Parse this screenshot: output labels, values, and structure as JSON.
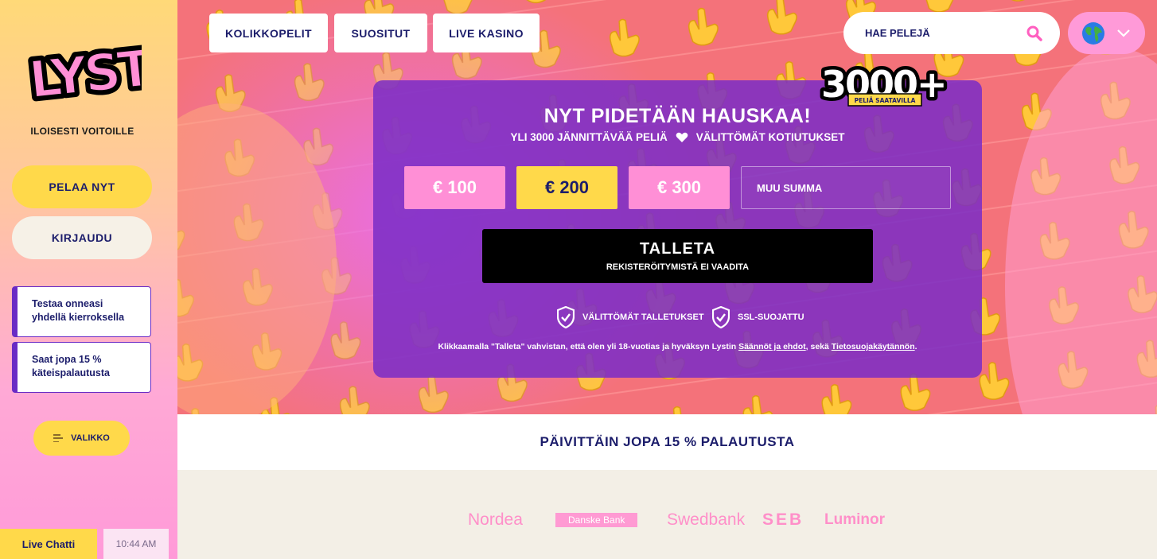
{
  "sidebar": {
    "logo_text": "LYSTI",
    "tagline": "ILOISESTI VOITOILLE",
    "play_label": "PELAA NYT",
    "login_label": "KIRJAUDU",
    "promos": [
      {
        "line1": "Testaa onneasi",
        "line2": "yhdellä kierroksella"
      },
      {
        "line1": "Saat jopa 15 %",
        "line2": "käteispalautusta"
      }
    ],
    "menu_label": "VALIKKO",
    "live_chat_label": "Live Chatti",
    "clock": "10:44 AM"
  },
  "nav": {
    "tabs": [
      {
        "label": "KOLIKKOPELIT"
      },
      {
        "label": "SUOSITUT"
      },
      {
        "label": "LIVE KASINO"
      }
    ],
    "search_placeholder": "HAE PELEJÄ",
    "language_icon": "globe-icon"
  },
  "badge": {
    "number": "3000+",
    "caption": "PELIÄ SAATAVILLA"
  },
  "deposit": {
    "title": "NYT PIDETÄÄN HAUSKAA!",
    "sub_left": "YLI 3000 JÄNNITTÄVÄÄ PELIÄ",
    "sub_right": "VÄLITTÖMÄT KOTIUTUKSET",
    "amounts": [
      "€ 100",
      "€ 200",
      "€ 300"
    ],
    "selected_amount": "€ 200",
    "custom_placeholder": "MUU SUMMA",
    "button_label": "TALLETA",
    "button_sub": "REKISTERÖITYMISTÄ EI VAADITA",
    "features": [
      "VÄLITTÖMÄT TALLETUKSET",
      "SSL-SUOJATTU"
    ],
    "legal_pre": "Klikkaamalla \"Talleta\" vahvistan, että olen yli 18-vuotias ja hyväksyn Lystin ",
    "legal_link1": "Säännöt ja ehdot",
    "legal_mid": ", sekä ",
    "legal_link2": "Tietosuojakäytännön",
    "legal_post": "."
  },
  "banner": {
    "text": "PÄIVITTÄIN JOPA 15 % PALAUTUSTA"
  },
  "banks": [
    "Nordea",
    "Danske Bank",
    "Swedbank",
    "SEB",
    "Luminor"
  ],
  "colors": {
    "navy": "#1c1d6b",
    "yellow": "#ffd94a",
    "pink": "#ff8fd6",
    "purple": "#7a2cc6",
    "hero_bg": "#f4727a"
  }
}
